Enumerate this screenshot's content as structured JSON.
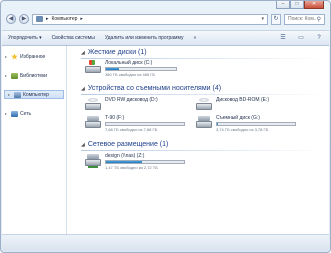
{
  "window": {
    "minimize_glyph": "–",
    "maximize_glyph": "□",
    "close_glyph": "✕"
  },
  "address_bar": {
    "back_glyph": "◀",
    "forward_glyph": "▶",
    "path_prefix": "▸",
    "path": "Компьютер",
    "path_suffix": "▸",
    "dropdown_glyph": "▾",
    "refresh_glyph": "↻",
    "search_placeholder": "Поиск: Ком...",
    "search_glyph": "⚲"
  },
  "toolbar": {
    "organize": "Упорядочить ▾",
    "system_properties": "Свойства системы",
    "uninstall": "Удалить или изменить программу",
    "more": "»",
    "view_icon": "view-options-icon",
    "preview_icon": "preview-pane-icon",
    "help_icon": "help-icon"
  },
  "nav_pane": {
    "items": [
      {
        "label": "Избранное",
        "icon": "star-icon"
      },
      {
        "label": "Библиотеки",
        "icon": "library-icon"
      },
      {
        "label": "Компьютер",
        "icon": "computer-icon",
        "selected": true
      },
      {
        "label": "Сеть",
        "icon": "network-icon"
      }
    ]
  },
  "groups": {
    "hard_drives": {
      "title": "Жесткие диски (1)",
      "drives": [
        {
          "name": "Локальный диск (C:)",
          "free": "380 ГБ свободно из 465 ГБ",
          "used_fraction": 0.18
        }
      ]
    },
    "removable": {
      "title": "Устройства со съемными носителями (4)",
      "drives": [
        {
          "name": "DVD RW дисковод (D:)"
        },
        {
          "name": "Дисковод BD-ROM (E:)"
        },
        {
          "name": "T-90 (F:)",
          "free": "7,68 ГБ свободно из 7,68 ГБ",
          "used_fraction": 0.0
        },
        {
          "name": "Съемный диск (G:)",
          "free": "3,74 ГБ свободно из 3,78 ГБ",
          "used_fraction": 0.01
        }
      ]
    },
    "network": {
      "title": "Сетевое размещение (1)",
      "drives": [
        {
          "name": "design (\\\\nas) (Z:)",
          "free": "1,47 ТБ свободно из 2,72 ТБ",
          "used_fraction": 0.46
        }
      ]
    }
  },
  "colors": {
    "accent": "#1e3f8a",
    "bar_fill": "#2a86cc"
  }
}
